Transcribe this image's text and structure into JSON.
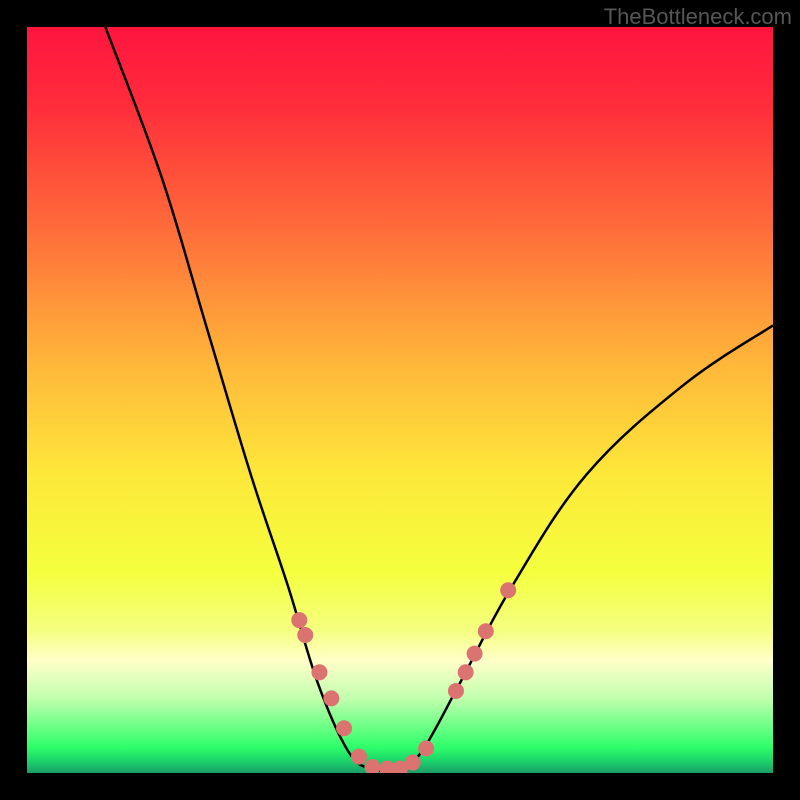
{
  "attribution": "TheBottleneck.com",
  "chart_data": {
    "type": "line",
    "title": "",
    "xlabel": "",
    "ylabel": "",
    "xlim": [
      0,
      100
    ],
    "ylim": [
      0,
      100
    ],
    "curve": {
      "description": "V-shaped bottleneck curve drawn over a vertical hue gradient from red (high) through yellow to green (low). The curve falls steeply from top-left, reaches a flat minimum around x=48, then rises toward the right edge at roughly mid-height.",
      "minimum_x": 48,
      "points": [
        {
          "x": 10.5,
          "y": 100
        },
        {
          "x": 18,
          "y": 80
        },
        {
          "x": 24,
          "y": 60
        },
        {
          "x": 30,
          "y": 40
        },
        {
          "x": 35,
          "y": 25
        },
        {
          "x": 39,
          "y": 12
        },
        {
          "x": 43,
          "y": 3
        },
        {
          "x": 46,
          "y": 0.6
        },
        {
          "x": 50,
          "y": 0.6
        },
        {
          "x": 53,
          "y": 3
        },
        {
          "x": 58,
          "y": 12
        },
        {
          "x": 65,
          "y": 25
        },
        {
          "x": 75,
          "y": 40
        },
        {
          "x": 88,
          "y": 52
        },
        {
          "x": 100,
          "y": 60
        }
      ],
      "stroke": "#000000",
      "stroke_width": 2.5
    },
    "markers": {
      "color": "#db7371",
      "radius_px": 8,
      "points": [
        {
          "x": 36.5,
          "y": 20.5
        },
        {
          "x": 37.3,
          "y": 18.5
        },
        {
          "x": 39.2,
          "y": 13.5
        },
        {
          "x": 40.8,
          "y": 10.0
        },
        {
          "x": 42.5,
          "y": 6.0
        },
        {
          "x": 44.5,
          "y": 2.2
        },
        {
          "x": 46.3,
          "y": 0.8
        },
        {
          "x": 48.3,
          "y": 0.6
        },
        {
          "x": 50.0,
          "y": 0.6
        },
        {
          "x": 51.7,
          "y": 1.4
        },
        {
          "x": 53.5,
          "y": 3.3
        },
        {
          "x": 57.5,
          "y": 11.0
        },
        {
          "x": 58.8,
          "y": 13.5
        },
        {
          "x": 60.0,
          "y": 16.0
        },
        {
          "x": 61.5,
          "y": 19.0
        },
        {
          "x": 64.5,
          "y": 24.5
        }
      ]
    },
    "gradient_stops": [
      {
        "offset": 0.0,
        "color": "#ff153f"
      },
      {
        "offset": 0.1,
        "color": "#ff2b3b"
      },
      {
        "offset": 0.25,
        "color": "#ff643a"
      },
      {
        "offset": 0.45,
        "color": "#ffb63a"
      },
      {
        "offset": 0.6,
        "color": "#fde83a"
      },
      {
        "offset": 0.73,
        "color": "#f4ff3d"
      },
      {
        "offset": 0.81,
        "color": "#f5ff82"
      },
      {
        "offset": 0.85,
        "color": "#ffffc8"
      },
      {
        "offset": 0.9,
        "color": "#c1ffad"
      },
      {
        "offset": 0.965,
        "color": "#2eff6a"
      },
      {
        "offset": 0.985,
        "color": "#1bd06a"
      },
      {
        "offset": 1.0,
        "color": "#1a9e68"
      }
    ]
  }
}
